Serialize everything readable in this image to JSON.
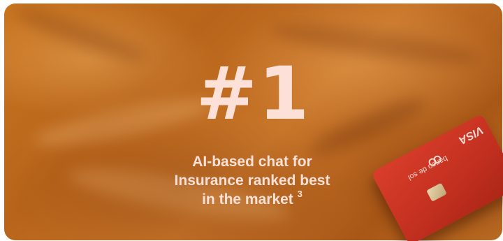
{
  "promo": {
    "headline": "#1",
    "tagline_line1": "AI-based chat for",
    "tagline_line2": "Insurance ranked best",
    "tagline_line3": "in the market",
    "footnote": "3"
  },
  "colors": {
    "headline_text": "#fde1d8",
    "background": "#c97521",
    "card_red": "#d93e2a"
  },
  "credit_card": {
    "brand": "banco de sol",
    "network": "VISA"
  }
}
